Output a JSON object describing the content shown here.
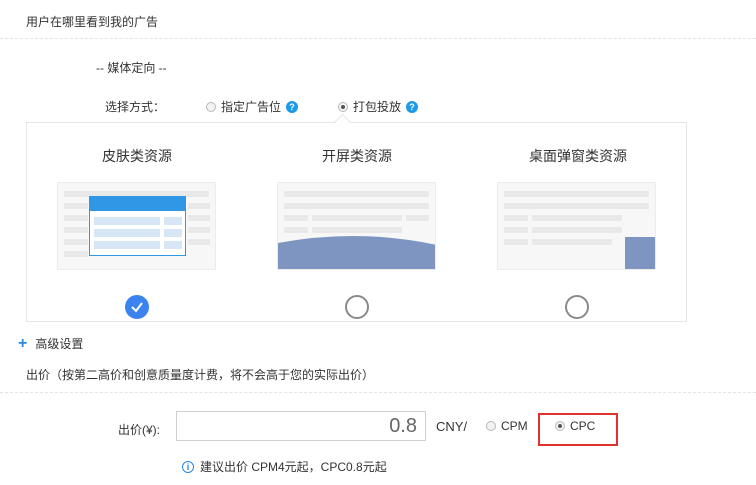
{
  "section": {
    "title": "用户在哪里看到我的广告",
    "media_label": "-- 媒体定向 --",
    "choose_label": "选择方式："
  },
  "targeting_options": [
    {
      "label": "指定广告位",
      "selected": false
    },
    {
      "label": "打包投放",
      "selected": true
    }
  ],
  "resource_cards": [
    {
      "title": "皮肤类资源",
      "selected": true
    },
    {
      "title": "开屏类资源",
      "selected": false
    },
    {
      "title": "桌面弹窗类资源",
      "selected": false
    }
  ],
  "advanced": {
    "label": "高级设置"
  },
  "bid": {
    "title": "出价（按第二高价和创意质量度计费，将不会高于您的实际出价）",
    "field_label": "出价(¥):",
    "value": "0.8",
    "unit": "CNY/",
    "pricing_options": [
      {
        "label": "CPM",
        "selected": false
      },
      {
        "label": "CPC",
        "selected": true
      }
    ],
    "tip": "建议出价 CPM4元起，CPC0.8元起"
  },
  "colors": {
    "accent_blue": "#3a83f0",
    "help_blue": "#1e9be8",
    "highlight_red": "#e03030",
    "thumb_fill": "#7e95c2"
  }
}
